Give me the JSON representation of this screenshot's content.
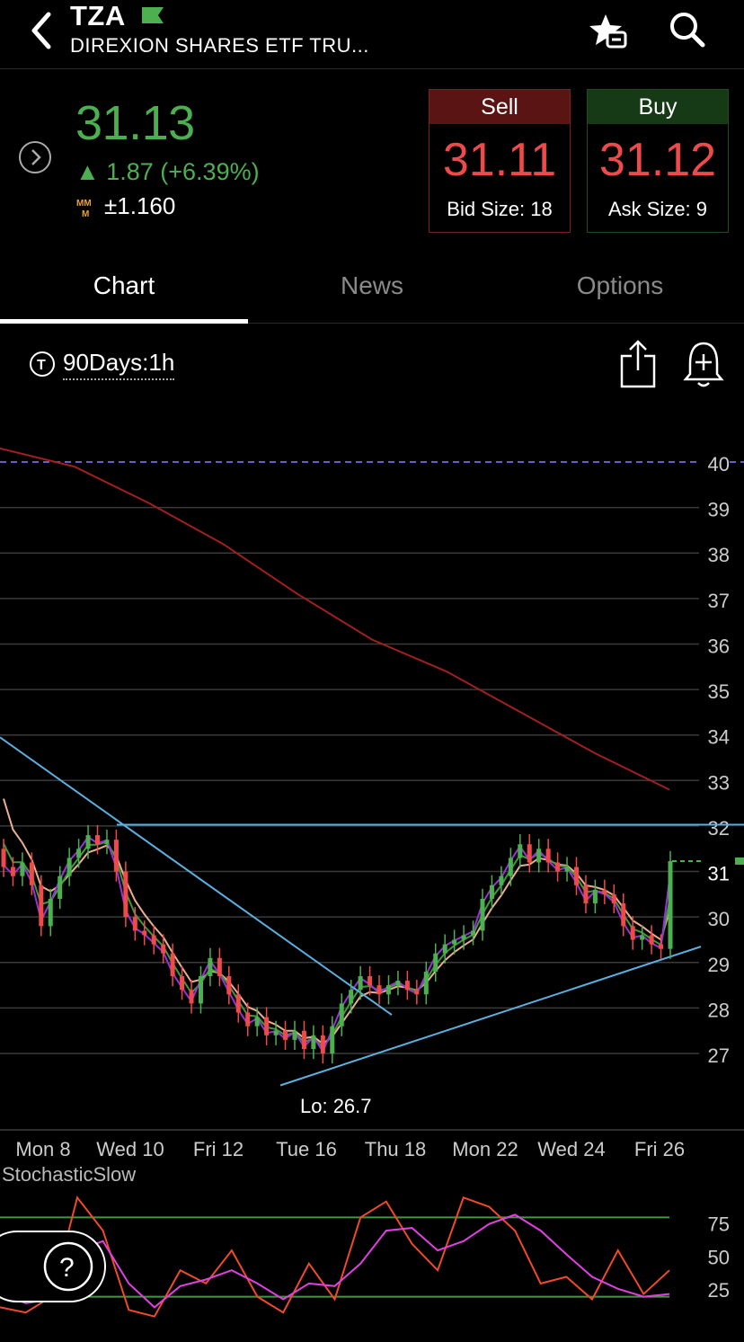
{
  "header": {
    "ticker": "TZA",
    "company": "DIREXION SHARES ETF TRU...",
    "flag_color": "#4caf50"
  },
  "quote": {
    "price": "31.13",
    "change": "▲ 1.87 (+6.39%)",
    "mm_icon": "MM\nM",
    "mm_value": "±1.160",
    "sell": {
      "label": "Sell",
      "price": "31.11",
      "size": "Bid Size: 18"
    },
    "buy": {
      "label": "Buy",
      "price": "31.12",
      "size": "Ask Size: 9"
    }
  },
  "tabs": [
    {
      "label": "Chart",
      "active": true
    },
    {
      "label": "News",
      "active": false
    },
    {
      "label": "Options",
      "active": false
    }
  ],
  "toolbar": {
    "period": "90Days:1h"
  },
  "chart_data": {
    "type": "candlestick",
    "y_axis_ticks": [
      "40",
      "39",
      "38",
      "37",
      "36",
      "35",
      "34",
      "33",
      "32",
      "31",
      "30",
      "29",
      "28",
      "27"
    ],
    "ylim": [
      26,
      40.5
    ],
    "x_tick_labels": [
      "Mon 8",
      "Wed 10",
      "Fri 12",
      "Tue 16",
      "Thu 18",
      "Mon 22",
      "Wed 24",
      "Fri 26"
    ],
    "low_label": "Lo: 26.7",
    "last_price": 31.13,
    "colors": {
      "up": "#4caf50",
      "down": "#ef4a4a",
      "ma_fast": "#9b30d9",
      "ma_mid": "#3c9a3c",
      "ma_slow": "#e8b090",
      "ma_long": "#a02020",
      "trendline": "#5bb0e0",
      "dashed_level": "#6a5acd"
    },
    "series": [
      {
        "name": "close",
        "values": [
          31.0,
          30.8,
          31.1,
          30.6,
          29.7,
          30.3,
          30.8,
          31.2,
          31.4,
          31.7,
          31.5,
          31.6,
          30.9,
          29.9,
          29.6,
          29.5,
          29.3,
          29.1,
          28.6,
          28.3,
          28.0,
          28.6,
          29.0,
          28.6,
          28.2,
          27.8,
          27.5,
          27.7,
          27.3,
          27.4,
          27.2,
          27.4,
          27.0,
          27.3,
          26.9,
          27.5,
          28.0,
          28.3,
          28.6,
          28.4,
          28.2,
          28.4,
          28.5,
          28.3,
          28.2,
          28.7,
          29.1,
          29.3,
          29.4,
          29.5,
          29.6,
          30.3,
          30.6,
          30.8,
          31.2,
          31.5,
          31.1,
          31.4,
          31.1,
          30.9,
          31.0,
          30.6,
          30.2,
          30.5,
          30.4,
          30.2,
          29.7,
          29.4,
          29.5,
          29.3,
          29.2,
          31.13
        ]
      },
      {
        "name": "sma_200_series",
        "values": [
          40.2,
          39.8,
          39.0,
          38.1,
          37.0,
          36.0,
          35.3,
          34.4,
          33.5,
          32.7
        ]
      }
    ],
    "stochastic": {
      "title": "StochasticSlow",
      "ticks": [
        "75",
        "50",
        "25"
      ],
      "k": [
        12,
        8,
        20,
        95,
        70,
        10,
        5,
        40,
        30,
        55,
        20,
        8,
        45,
        18,
        80,
        92,
        60,
        40,
        95,
        88,
        70,
        30,
        35,
        18,
        55,
        22,
        40
      ],
      "d": [
        22,
        15,
        18,
        55,
        62,
        30,
        12,
        28,
        33,
        40,
        30,
        18,
        30,
        28,
        45,
        70,
        72,
        55,
        62,
        75,
        82,
        70,
        52,
        35,
        26,
        20,
        22
      ]
    }
  },
  "help": {
    "label": "?"
  }
}
